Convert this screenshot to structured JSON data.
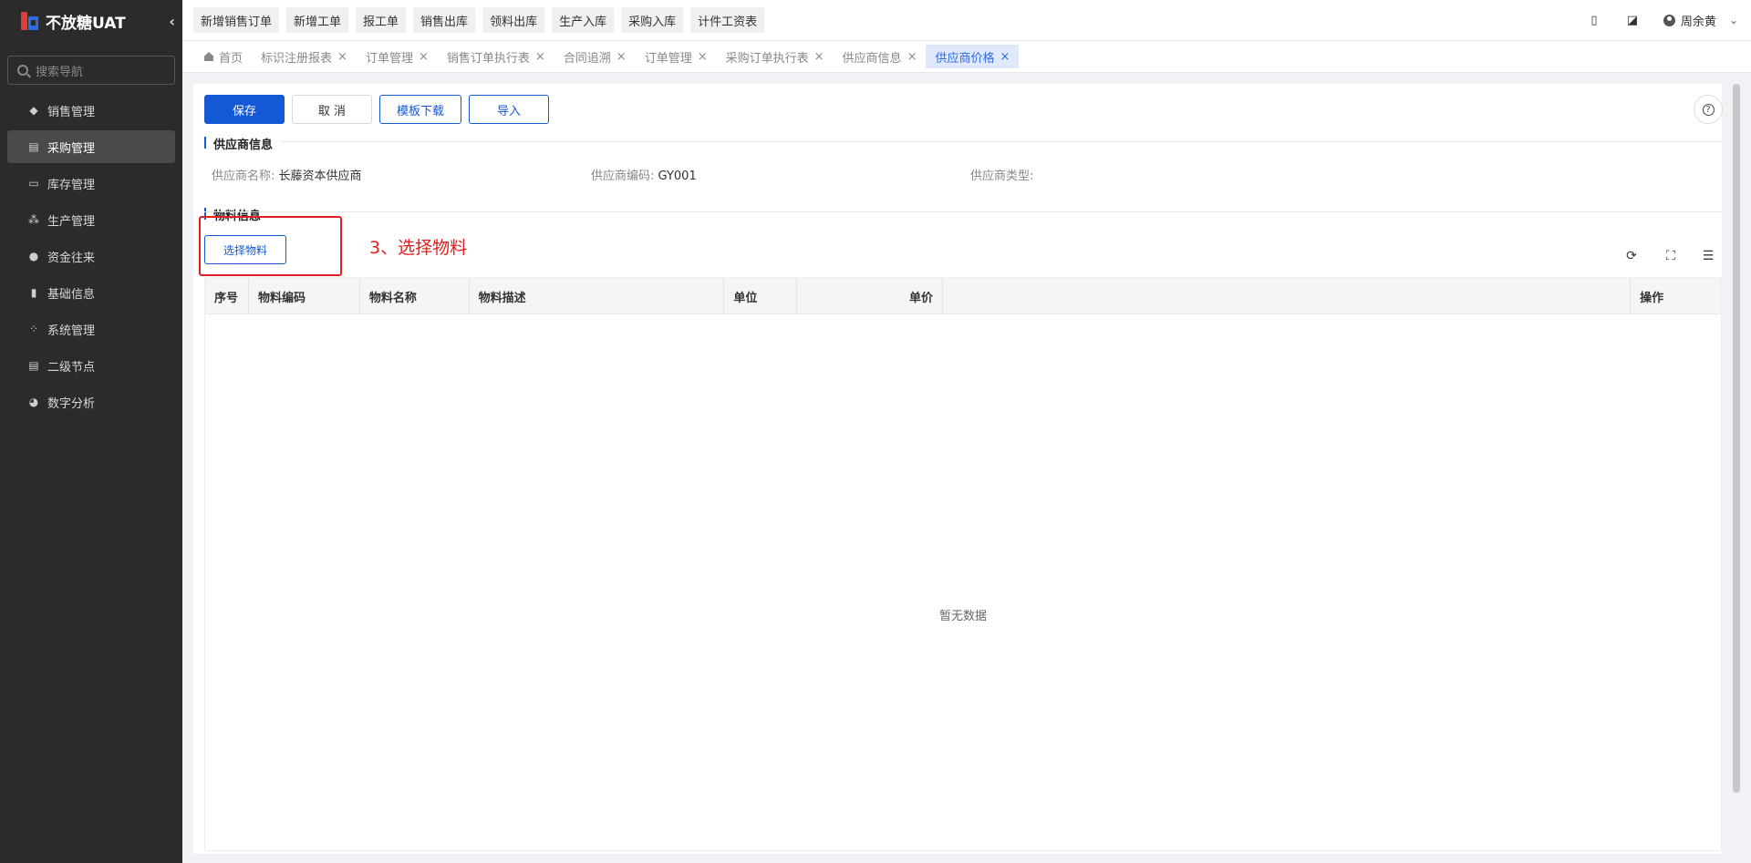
{
  "app": {
    "title": "不放糖UAT",
    "collapse_icon": "chevron-left-icon"
  },
  "sidebar": {
    "search_placeholder": "搜索导航",
    "items": [
      {
        "label": "销售管理",
        "icon": "tag-icon",
        "glyph": "◆"
      },
      {
        "label": "采购管理",
        "icon": "cart-icon",
        "glyph": "▤",
        "active": true
      },
      {
        "label": "库存管理",
        "icon": "box-icon",
        "glyph": "▭"
      },
      {
        "label": "生产管理",
        "icon": "nodes-icon",
        "glyph": "⁂"
      },
      {
        "label": "资金往来",
        "icon": "coin-icon",
        "glyph": "●"
      },
      {
        "label": "基础信息",
        "icon": "chart-icon",
        "glyph": "▮"
      },
      {
        "label": "系统管理",
        "icon": "grid-icon",
        "glyph": "⁘"
      },
      {
        "label": "二级节点",
        "icon": "doc-icon",
        "glyph": "▤"
      },
      {
        "label": "数字分析",
        "icon": "pie-icon",
        "glyph": "◕"
      }
    ]
  },
  "topbar": {
    "quick_links": [
      "新增销售订单",
      "新增工单",
      "报工单",
      "销售出库",
      "领料出库",
      "生产入库",
      "采购入库",
      "计件工资表"
    ],
    "user_name": "周余黄",
    "icons": [
      "mobile-icon",
      "chart-line-icon",
      "user-icon",
      "chevron-down-icon"
    ]
  },
  "tabs": [
    {
      "label": "首页",
      "closable": false
    },
    {
      "label": "标识注册报表",
      "closable": true
    },
    {
      "label": "订单管理",
      "closable": true
    },
    {
      "label": "销售订单执行表",
      "closable": true
    },
    {
      "label": "合同追溯",
      "closable": true
    },
    {
      "label": "订单管理",
      "closable": true
    },
    {
      "label": "采购订单执行表",
      "closable": true
    },
    {
      "label": "供应商信息",
      "closable": true
    },
    {
      "label": "供应商价格",
      "closable": true,
      "active": true
    }
  ],
  "toolbar": {
    "save": "保存",
    "cancel": "取 消",
    "template_download": "模板下载",
    "import": "导入"
  },
  "supplier_section": {
    "title": "供应商信息",
    "name_label": "供应商名称:",
    "name_value": "长藤资本供应商",
    "code_label": "供应商编码:",
    "code_value": "GY001",
    "type_label": "供应商类型:",
    "type_value": ""
  },
  "material_section": {
    "title": "物料信息",
    "select_button": "选择物料",
    "annotation": "3、选择物料",
    "columns": [
      "序号",
      "物料编码",
      "物料名称",
      "物料描述",
      "单位",
      "单价",
      "",
      "操作"
    ],
    "empty_text": "暂无数据",
    "tools": [
      "refresh-icon",
      "fullscreen-icon",
      "settings-icon"
    ]
  },
  "colors": {
    "primary": "#1558d6",
    "sidebar_bg": "#2b2b2b",
    "annotation": "#e02020"
  }
}
